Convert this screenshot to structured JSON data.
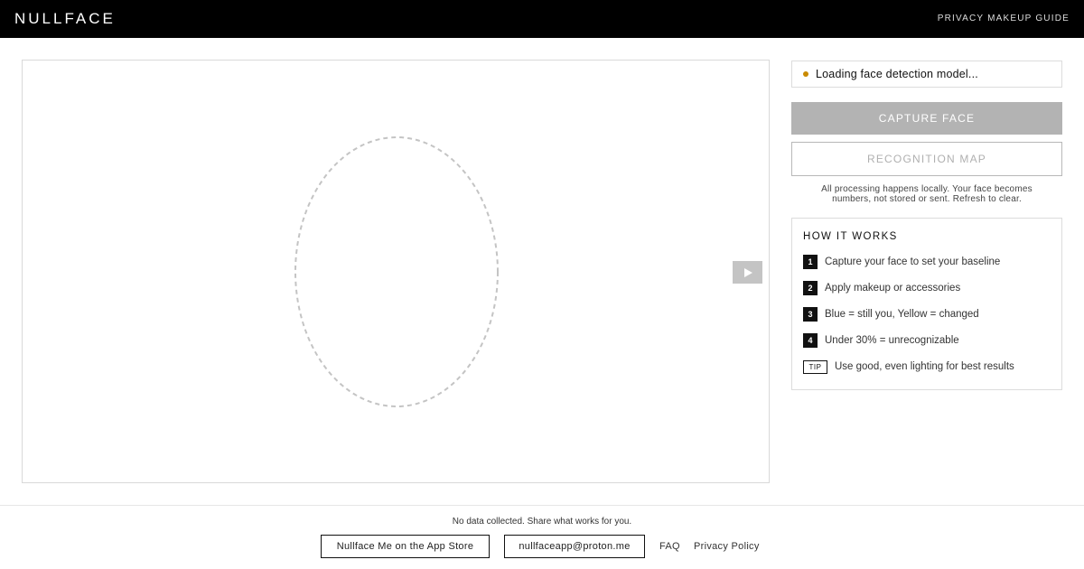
{
  "header": {
    "logo": "NULLFACE",
    "guide_link": "PRIVACY MAKEUP GUIDE"
  },
  "camera": {
    "face_guide_icon": "dashed-oval",
    "play_icon": "play-icon"
  },
  "status": {
    "text": "Loading face detection model...",
    "dot_color": "#c98a00"
  },
  "actions": {
    "capture_label": "CAPTURE FACE",
    "map_label": "RECOGNITION MAP"
  },
  "privacy_note": {
    "line1": "All processing happens locally. Your face becomes",
    "line2": "numbers, not stored or sent. Refresh to clear."
  },
  "how_it_works": {
    "title": "HOW IT WORKS",
    "steps": [
      {
        "num": "1",
        "text": "Capture your face to set your baseline"
      },
      {
        "num": "2",
        "text": "Apply makeup or accessories"
      },
      {
        "num": "3",
        "text": "Blue = still you, Yellow = changed"
      },
      {
        "num": "4",
        "text": "Under 30% = unrecognizable"
      }
    ],
    "tip": {
      "tag": "TIP",
      "text": "Use good, even lighting for best results"
    }
  },
  "footer": {
    "note": "No data collected. Share what works for you.",
    "app_store_label": "Nullface Me on the App Store",
    "email_label": "nullfaceapp@proton.me",
    "faq_label": "FAQ",
    "privacy_label": "Privacy Policy"
  }
}
